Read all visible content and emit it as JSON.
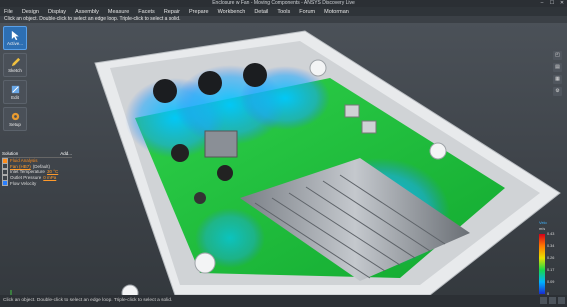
{
  "window": {
    "title": "Enclosure w Fan - Moving Components - ANSYS Discovery Live",
    "controls": [
      "–",
      "☐",
      "✕"
    ]
  },
  "menu": {
    "items": [
      "File",
      "Design",
      "Display",
      "Assembly",
      "Measure",
      "Facets",
      "Repair",
      "Prepare",
      "Workbench",
      "Detail",
      "Tools",
      "Forum",
      "Motorman"
    ]
  },
  "hint": {
    "text": "Click an object. Double-click to select an edge loop. Triple-click to select a solid."
  },
  "tools": {
    "active": "Active...",
    "sketch": "Sketch",
    "edit": "Edit",
    "setup": "Setup"
  },
  "tree": {
    "header": "Solution",
    "header_right": "Add...",
    "rows": [
      {
        "label": "Fluid Analysis",
        "value": ""
      },
      {
        "label": "Fan (HB7)",
        "value": "(Default)"
      },
      {
        "label": "Inlet Temperature",
        "value": "30 °C"
      },
      {
        "label": "Outlet Pressure",
        "value": "0 mPa"
      },
      {
        "label": "Flow Velocity",
        "value": ""
      }
    ]
  },
  "legend": {
    "title": "Velo",
    "unit": "m/s",
    "ticks": [
      "0.43",
      "0.34",
      "0.26",
      "0.17",
      "0.09",
      "0"
    ]
  },
  "status": {
    "text": "Click an object. Double-click to select an edge loop. Triple-click to select a solid."
  },
  "colors": {
    "accent": "#2d6fb3",
    "highlight": "#ff8c1a"
  }
}
